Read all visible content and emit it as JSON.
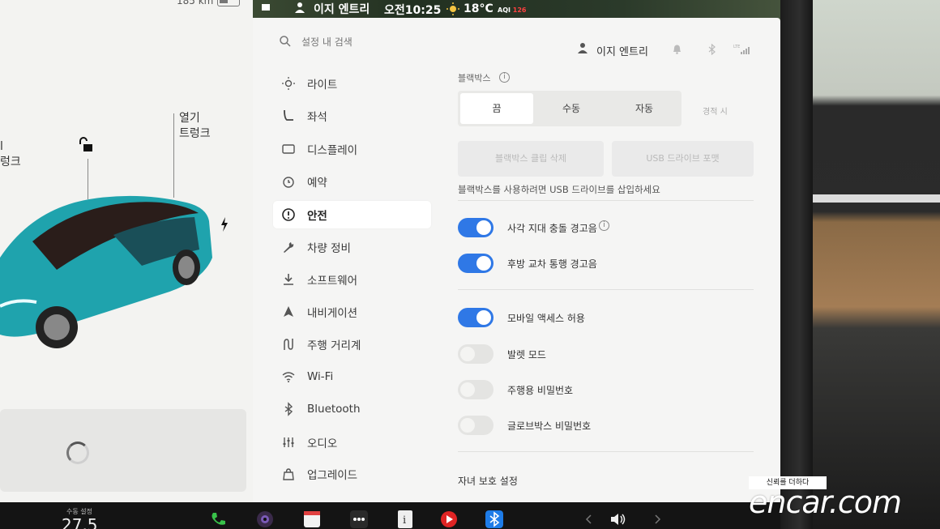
{
  "status_bar": {
    "user": "이지 엔트리",
    "time": "오전10:25",
    "temperature": "18°C",
    "aqi_label": "AQI",
    "aqi_value": "126"
  },
  "car_panel": {
    "range": "185 km",
    "left_label": "l\n렁크",
    "trunk_label": "열기\n트렁크"
  },
  "search": {
    "placeholder": "설정 내 검색"
  },
  "header": {
    "user_name": "이지 엔트리"
  },
  "sidebar": {
    "items": [
      {
        "label": "라이트",
        "icon": "light-icon"
      },
      {
        "label": "좌석",
        "icon": "seat-icon"
      },
      {
        "label": "디스플레이",
        "icon": "display-icon"
      },
      {
        "label": "예약",
        "icon": "schedule-icon"
      },
      {
        "label": "안전",
        "icon": "safety-icon",
        "active": true
      },
      {
        "label": "차량 정비",
        "icon": "wrench-icon"
      },
      {
        "label": "소프트웨어",
        "icon": "download-icon"
      },
      {
        "label": "내비게이션",
        "icon": "navigation-icon"
      },
      {
        "label": "주행 거리계",
        "icon": "trip-icon"
      },
      {
        "label": "Wi-Fi",
        "icon": "wifi-icon"
      },
      {
        "label": "Bluetooth",
        "icon": "bluetooth-icon"
      },
      {
        "label": "오디오",
        "icon": "audio-icon"
      },
      {
        "label": "업그레이드",
        "icon": "upgrade-icon"
      }
    ]
  },
  "dashcam": {
    "label": "블랙박스",
    "options": [
      "끔",
      "수동",
      "자동"
    ],
    "selected": "끔",
    "extra_option": "경적 시",
    "delete_clips": "블랙박스 클립 삭제",
    "format_usb": "USB 드라이브 포맷",
    "note": "블랙박스를 사용하려면 USB 드라이브를 삽입하세요"
  },
  "toggles": [
    {
      "label": "사각 지대 충돌 경고음",
      "on": true
    },
    {
      "label": "후방 교차 통행 경고음",
      "on": true
    },
    {
      "label": "모바일 액세스 허용",
      "on": true
    },
    {
      "label": "발렛 모드",
      "on": false
    },
    {
      "label": "주행용 비밀번호",
      "on": false
    },
    {
      "label": "글로브박스 비밀번호",
      "on": false
    }
  ],
  "child_section": {
    "title": "자녀 보호 설정"
  },
  "taskbar": {
    "temp_label": "수동 설정",
    "temp_value": "27.5"
  },
  "watermark": {
    "tag": "신뢰를 더하다",
    "logo": "encar.com"
  },
  "colors": {
    "toggle_on": "#2f78e6",
    "car_paint": "#1fa3ad",
    "aqi": "#ff4040"
  }
}
